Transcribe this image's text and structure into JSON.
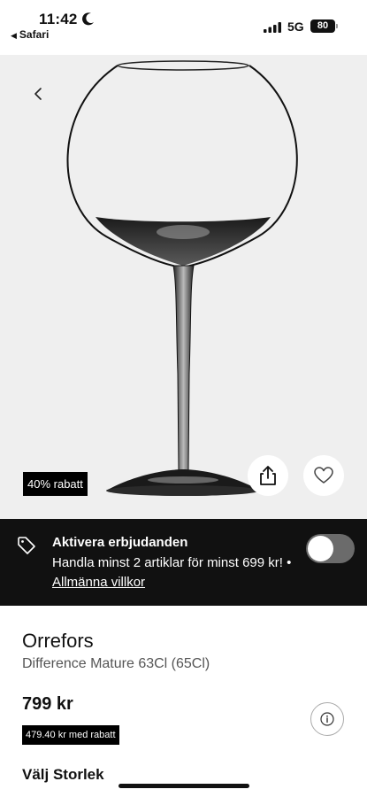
{
  "status_bar": {
    "time": "11:42",
    "back_app": "Safari",
    "network": "5G",
    "battery": "80"
  },
  "image": {
    "discount_badge": "40% rabatt",
    "icons": [
      "chevron-left-icon",
      "share-icon",
      "heart-icon"
    ]
  },
  "offer": {
    "title": "Aktivera erbjudanden",
    "text": "Handla minst 2 artiklar för minst 699 kr! •",
    "link": "Allmänna villkor",
    "toggle_on": false
  },
  "product": {
    "brand": "Orrefors",
    "name": "Difference Mature 63Cl (65Cl)",
    "price": "799 kr",
    "discount_price": "479.40 kr med rabatt",
    "size_heading": "Välj Storlek"
  },
  "colors": {
    "banner_bg": "#111111",
    "image_bg": "#efefef",
    "badge_bg": "#000000"
  }
}
